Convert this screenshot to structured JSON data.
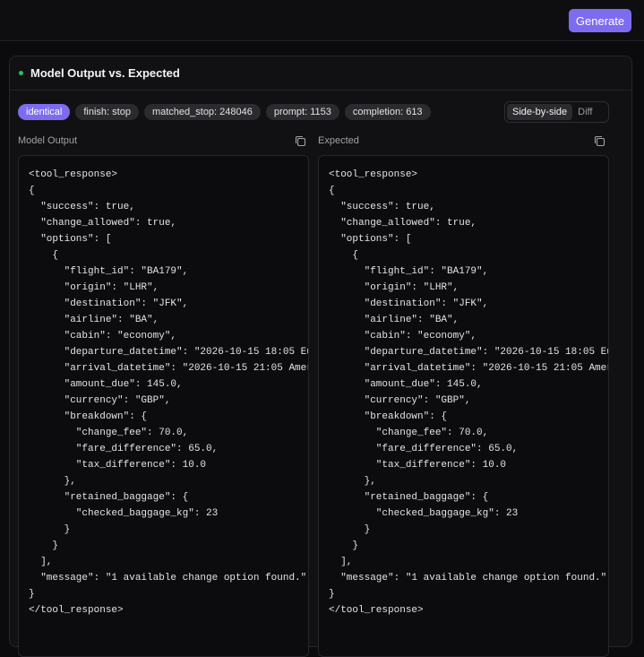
{
  "header": {
    "generate_label": "Generate"
  },
  "panel": {
    "title": "Model Output vs. Expected",
    "badges": [
      "identical",
      "finish: stop",
      "matched_stop: 248046",
      "prompt: 1153",
      "completion: 613"
    ],
    "view_toggle": {
      "options": [
        "Side-by-side",
        "Diff"
      ],
      "selected": "Side-by-side"
    },
    "model_output": {
      "label": "Model Output",
      "code": "<tool_response>\n{\n  \"success\": true,\n  \"change_allowed\": true,\n  \"options\": [\n    {\n      \"flight_id\": \"BA179\",\n      \"origin\": \"LHR\",\n      \"destination\": \"JFK\",\n      \"airline\": \"BA\",\n      \"cabin\": \"economy\",\n      \"departure_datetime\": \"2026-10-15 18:05 Eu\n      \"arrival_datetime\": \"2026-10-15 21:05 Amer\n      \"amount_due\": 145.0,\n      \"currency\": \"GBP\",\n      \"breakdown\": {\n        \"change_fee\": 70.0,\n        \"fare_difference\": 65.0,\n        \"tax_difference\": 10.0\n      },\n      \"retained_baggage\": {\n        \"checked_baggage_kg\": 23\n      }\n    }\n  ],\n  \"message\": \"1 available change option found.\"\n}\n</tool_response>"
    },
    "expected": {
      "label": "Expected",
      "code": "<tool_response>\n{\n  \"success\": true,\n  \"change_allowed\": true,\n  \"options\": [\n    {\n      \"flight_id\": \"BA179\",\n      \"origin\": \"LHR\",\n      \"destination\": \"JFK\",\n      \"airline\": \"BA\",\n      \"cabin\": \"economy\",\n      \"departure_datetime\": \"2026-10-15 18:05 Eu\n      \"arrival_datetime\": \"2026-10-15 21:05 Amer\n      \"amount_due\": 145.0,\n      \"currency\": \"GBP\",\n      \"breakdown\": {\n        \"change_fee\": 70.0,\n        \"fare_difference\": 65.0,\n        \"tax_difference\": 10.0\n      },\n      \"retained_baggage\": {\n        \"checked_baggage_kg\": 23\n      }\n    }\n  ],\n  \"message\": \"1 available change option found.\"\n}\n</tool_response>"
    }
  },
  "icons": {
    "copy": "copy-icon",
    "status": "status-dot"
  },
  "colors": {
    "accent": "#7c6cf0",
    "status_ok": "#22c55e",
    "background": "#0b0b0d"
  }
}
